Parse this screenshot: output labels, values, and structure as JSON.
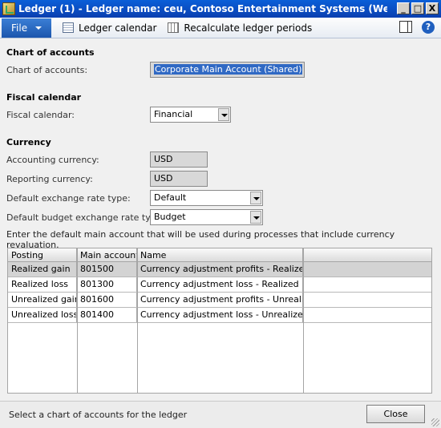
{
  "window": {
    "title": "Ledger (1) - Ledger name: ceu, Contoso Entertainment Systems (West), Ledger: ceu",
    "min_label": "_",
    "max_label": "□",
    "close_label": "X"
  },
  "actionpane": {
    "file_label": "File",
    "ledger_calendar_label": "Ledger calendar",
    "recalculate_label": "Recalculate ledger periods",
    "help_label": "?"
  },
  "chart_of_accounts": {
    "section_title": "Chart of accounts",
    "label": "Chart of accounts:",
    "value": "Corporate Main Account (Shared)"
  },
  "fiscal_calendar": {
    "section_title": "Fiscal calendar",
    "label": "Fiscal calendar:",
    "value": "Financial"
  },
  "currency": {
    "section_title": "Currency",
    "accounting_label": "Accounting currency:",
    "accounting_value": "USD",
    "reporting_label": "Reporting currency:",
    "reporting_value": "USD",
    "exchange_type_label": "Default exchange rate type:",
    "exchange_type_value": "Default",
    "budget_type_label": "Default budget exchange rate type:",
    "budget_type_value": "Budget"
  },
  "info_text": "Enter the default main account that will be used during processes that include currency revaluation.",
  "grid": {
    "headers": [
      "Posting",
      "Main account",
      "Name"
    ],
    "rows": [
      [
        "Realized gain",
        "801500",
        "Currency adjustment profits - Realized"
      ],
      [
        "Realized loss",
        "801300",
        "Currency adjustment loss - Realized"
      ],
      [
        "Unrealized gain",
        "801600",
        "Currency adjustment profits - Unrealized"
      ],
      [
        "Unrealized loss",
        "801400",
        "Currency adjustment loss - Unrealized"
      ]
    ]
  },
  "status": {
    "text": "Select a chart of accounts for the ledger",
    "close_label": "Close"
  },
  "colors": {
    "titlebar": "#0a4fc4",
    "file_button": "#2a6bc6",
    "selection": "#3069c4"
  }
}
